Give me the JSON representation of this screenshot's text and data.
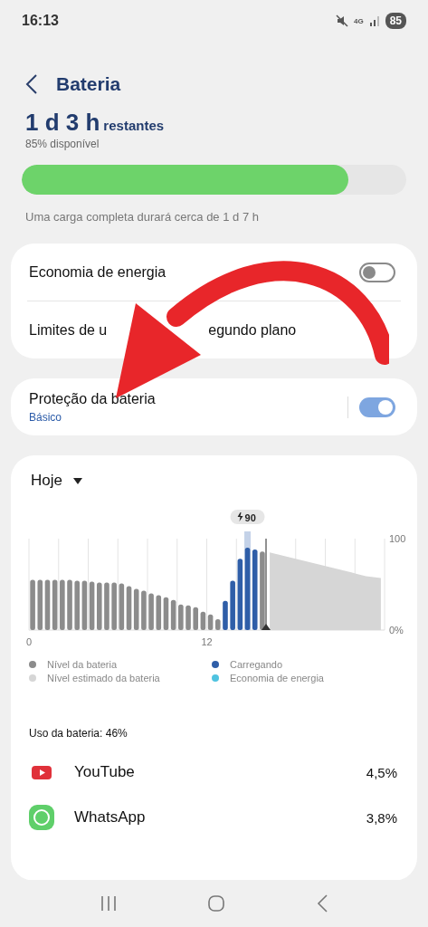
{
  "status_bar": {
    "time": "16:13",
    "network": "4G",
    "battery": "85"
  },
  "header": {
    "title": "Bateria"
  },
  "summary": {
    "remaining": "1 d 3 h",
    "remaining_unit": "restantes",
    "available": "85% disponível",
    "level": 0.85,
    "note": "Uma carga completa durará cerca de 1 d 7 h"
  },
  "settings_cards": [
    {
      "rows": [
        {
          "kind": "toggle",
          "label": "Economia de energia",
          "on": false
        },
        {
          "kind": "link",
          "label_parts": [
            "Limites de u",
            "egundo plano"
          ]
        }
      ]
    },
    {
      "rows": [
        {
          "kind": "toggle",
          "label": "Proteção da bateria",
          "sublabel": "Básico",
          "on": true
        }
      ]
    }
  ],
  "usage": {
    "period": "Hoje",
    "chart_data": {
      "type": "bar",
      "xlim": [
        0,
        24
      ],
      "ylim": [
        0,
        100
      ],
      "xticks": [
        0,
        12
      ],
      "yticks": [
        {
          "value": 0,
          "label": "0%"
        },
        {
          "value": 100,
          "label": "100"
        }
      ],
      "x": [
        0.25,
        0.75,
        1.25,
        1.75,
        2.25,
        2.75,
        3.25,
        3.75,
        4.25,
        4.75,
        5.25,
        5.75,
        6.25,
        6.75,
        7.25,
        7.75,
        8.25,
        8.75,
        9.25,
        9.75,
        10.25,
        10.75,
        11.25,
        11.75,
        12.25,
        12.75,
        13.25,
        13.75,
        14.25,
        14.75,
        15.25,
        15.75,
        16.25,
        16.75,
        17.25,
        17.75,
        18.25,
        18.75,
        19.25,
        19.75,
        20.25,
        20.75,
        21.25,
        21.75,
        22.25,
        22.75,
        23.25,
        23.75
      ],
      "series": [
        {
          "name": "Nível da bateria",
          "color": "#8c8c8c",
          "values": [
            55,
            55,
            55,
            55,
            55,
            55,
            54,
            54,
            53,
            52,
            52,
            52,
            51,
            48,
            45,
            43,
            40,
            38,
            36,
            33,
            28,
            27,
            25,
            20,
            17,
            12,
            null,
            null,
            null,
            null,
            null,
            86,
            null,
            null,
            null,
            null,
            null,
            null,
            null,
            null,
            null,
            null,
            null,
            null,
            null,
            null,
            null,
            null
          ]
        },
        {
          "name": "Carregando",
          "color": "#2f5ea8",
          "values": [
            null,
            null,
            null,
            null,
            null,
            null,
            null,
            null,
            null,
            null,
            null,
            null,
            null,
            null,
            null,
            null,
            null,
            null,
            null,
            null,
            null,
            null,
            null,
            null,
            null,
            null,
            32,
            54,
            78,
            90,
            88,
            null,
            null,
            null,
            null,
            null,
            null,
            null,
            null,
            null,
            null,
            null,
            null,
            null,
            null,
            null,
            null,
            null
          ]
        },
        {
          "name": "Nível estimado da bateria",
          "color": "#d6d6d6",
          "type": "area",
          "values": [
            null,
            null,
            null,
            null,
            null,
            null,
            null,
            null,
            null,
            null,
            null,
            null,
            null,
            null,
            null,
            null,
            null,
            null,
            null,
            null,
            null,
            null,
            null,
            null,
            null,
            null,
            null,
            null,
            null,
            null,
            null,
            null,
            85,
            83,
            81,
            79,
            77,
            75,
            73,
            71,
            69,
            67,
            65,
            63,
            61,
            59,
            58,
            57
          ]
        },
        {
          "name": "Economia de energia",
          "color": "#4fc3e0",
          "values": [
            null,
            null,
            null,
            null,
            null,
            null,
            null,
            null,
            null,
            null,
            null,
            null,
            null,
            null,
            null,
            null,
            null,
            null,
            null,
            null,
            null,
            null,
            null,
            null,
            null,
            null,
            null,
            null,
            null,
            null,
            null,
            null,
            null,
            null,
            null,
            null,
            null,
            null,
            null,
            null,
            null,
            null,
            null,
            null,
            null,
            null,
            null,
            null
          ]
        }
      ],
      "ref_lines": [
        {
          "axis": "x",
          "value": 16,
          "color": "#333333"
        }
      ]
    },
    "tooltip": {
      "label": "90"
    },
    "total": "Uso da bateria: 46%",
    "apps": [
      {
        "kind": "youtube",
        "name": "YouTube",
        "share": "4,5%"
      },
      {
        "kind": "whatsapp",
        "name": "WhatsApp",
        "share": "3,8%"
      }
    ]
  }
}
